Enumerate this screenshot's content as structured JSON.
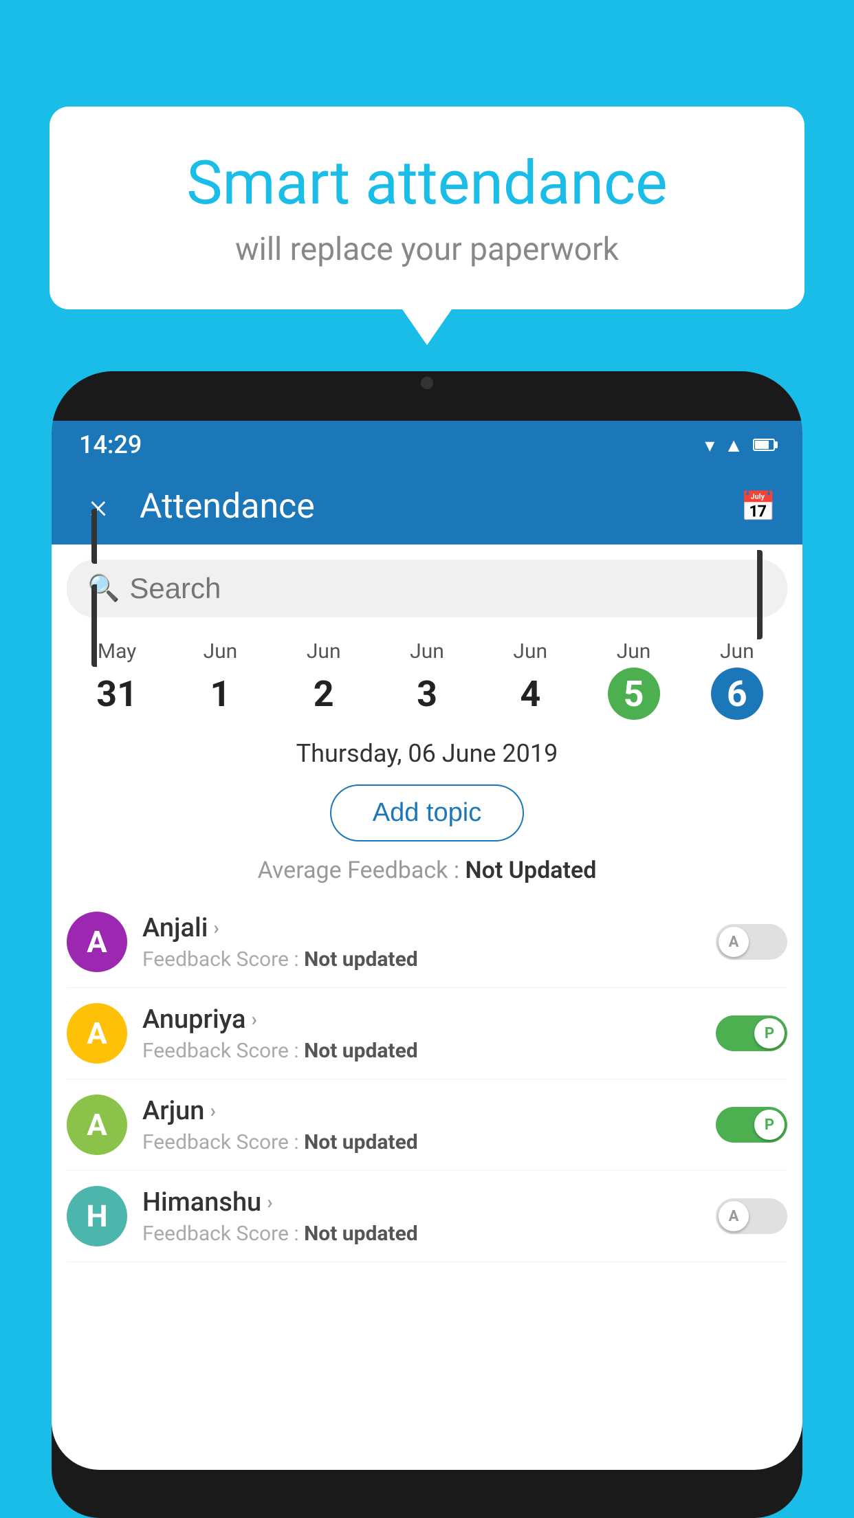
{
  "background": {
    "color": "#1ABDE8"
  },
  "speech_bubble": {
    "title": "Smart attendance",
    "subtitle": "will replace your paperwork"
  },
  "phone": {
    "status_bar": {
      "time": "14:29"
    },
    "toolbar": {
      "title": "Attendance",
      "close_label": "×"
    },
    "search": {
      "placeholder": "Search"
    },
    "dates": [
      {
        "month": "May",
        "day": "31",
        "style": "normal"
      },
      {
        "month": "Jun",
        "day": "1",
        "style": "normal"
      },
      {
        "month": "Jun",
        "day": "2",
        "style": "normal"
      },
      {
        "month": "Jun",
        "day": "3",
        "style": "normal"
      },
      {
        "month": "Jun",
        "day": "4",
        "style": "normal"
      },
      {
        "month": "Jun",
        "day": "5",
        "style": "green"
      },
      {
        "month": "Jun",
        "day": "6",
        "style": "blue"
      }
    ],
    "selected_date": "Thursday, 06 June 2019",
    "add_topic_label": "Add topic",
    "average_feedback_label": "Average Feedback :",
    "average_feedback_value": "Not Updated",
    "students": [
      {
        "name": "Anjali",
        "avatar_letter": "A",
        "avatar_color": "purple",
        "feedback_label": "Feedback Score :",
        "feedback_value": "Not updated",
        "toggle": "off",
        "toggle_letter": "A"
      },
      {
        "name": "Anupriya",
        "avatar_letter": "A",
        "avatar_color": "yellow",
        "feedback_label": "Feedback Score :",
        "feedback_value": "Not updated",
        "toggle": "on",
        "toggle_letter": "P"
      },
      {
        "name": "Arjun",
        "avatar_letter": "A",
        "avatar_color": "light-green",
        "feedback_label": "Feedback Score :",
        "feedback_value": "Not updated",
        "toggle": "on",
        "toggle_letter": "P"
      },
      {
        "name": "Himanshu",
        "avatar_letter": "H",
        "avatar_color": "teal",
        "feedback_label": "Feedback Score :",
        "feedback_value": "Not updated",
        "toggle": "off",
        "toggle_letter": "A"
      }
    ]
  }
}
